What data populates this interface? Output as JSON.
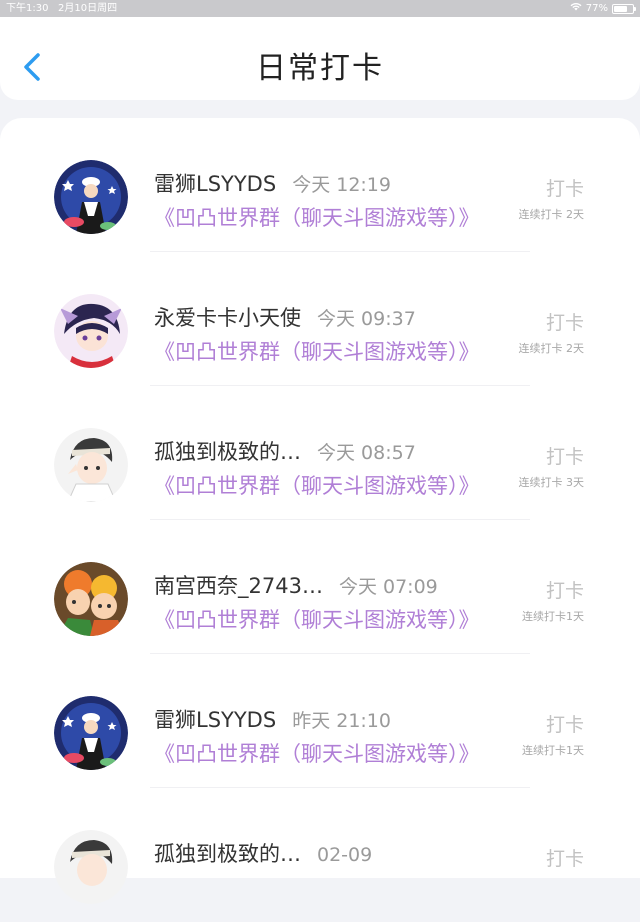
{
  "status_bar": {
    "time": "下午1:30",
    "date": "2月10日周四",
    "battery": "77%"
  },
  "header": {
    "title": "日常打卡",
    "back_icon": "chevron-left-icon",
    "accent_color": "#2d9cf0"
  },
  "feed": [
    {
      "name": "雷狮LSYYDS",
      "time": "今天 12:19",
      "group": "《凹凸世界群（聊天斗图游戏等）》",
      "action": "打卡",
      "streak": "连续打卡 2天"
    },
    {
      "name": "永爱卡卡小天使",
      "time": "今天 09:37",
      "group": "《凹凸世界群（聊天斗图游戏等）》",
      "action": "打卡",
      "streak": "连续打卡 2天"
    },
    {
      "name": "孤独到极致的…",
      "time": "今天 08:57",
      "group": "《凹凸世界群（聊天斗图游戏等）》",
      "action": "打卡",
      "streak": "连续打卡 3天"
    },
    {
      "name": "南宫西奈_2743…",
      "time": "今天 07:09",
      "group": "《凹凸世界群（聊天斗图游戏等）》",
      "action": "打卡",
      "streak": "连续打卡1天"
    },
    {
      "name": "雷狮LSYYDS",
      "time": "昨天 21:10",
      "group": "《凹凸世界群（聊天斗图游戏等）》",
      "action": "打卡",
      "streak": "连续打卡1天"
    },
    {
      "name": "孤独到极致的…",
      "time": "02-09",
      "group": "",
      "action": "打卡",
      "streak": ""
    }
  ]
}
